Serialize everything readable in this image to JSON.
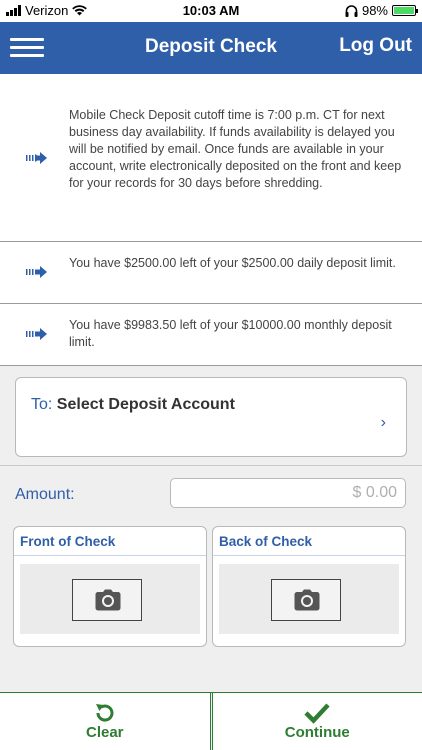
{
  "status_bar": {
    "carrier": "Verizon",
    "time": "10:03 AM",
    "battery": "98%"
  },
  "nav": {
    "title": "Deposit Check",
    "logout": "Log Out",
    "icons": {
      "menu": "hamburger-icon"
    }
  },
  "notices": [
    {
      "text": "Mobile Check Deposit cutoff time is 7:00 p.m. CT for next business day availability. If funds availability is delayed you will be notified by email. Once funds are available in your account, write electronically deposited on the front and keep for your records for 30 days before shredding."
    },
    {
      "text": "You have $2500.00 left of your $2500.00 daily deposit limit."
    },
    {
      "text": "You have $9983.50 left of your $10000.00 monthly deposit limit."
    }
  ],
  "account": {
    "prefix": "To: ",
    "placeholder": "Select Deposit Account"
  },
  "amount": {
    "label": "Amount:",
    "placeholder": "$ 0.00",
    "value": ""
  },
  "check": {
    "front_label": "Front of Check",
    "back_label": "Back of Check"
  },
  "actions": {
    "clear": "Clear",
    "continue": "Continue"
  },
  "colors": {
    "nav": "#2f5fa8",
    "accent": "#2f5fa8",
    "action": "#2e7d32"
  }
}
